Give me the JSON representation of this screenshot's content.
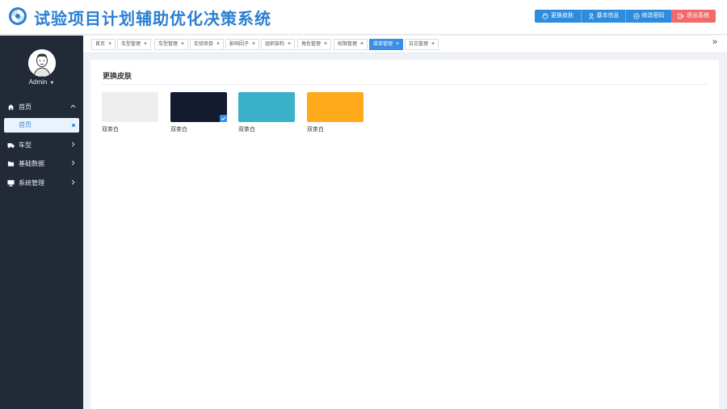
{
  "app": {
    "title": "试验项目计划辅助优化决策系统"
  },
  "header_buttons": {
    "change_skin": "更换皮肤",
    "basic_info": "基本信息",
    "change_password": "修改密码",
    "logout": "退出系统"
  },
  "user": {
    "name": "Admin"
  },
  "sidebar": {
    "items": [
      {
        "label": "首页",
        "icon": "home-icon",
        "expanded": true
      },
      {
        "label": "车型",
        "icon": "truck-icon",
        "expanded": false
      },
      {
        "label": "基础数据",
        "icon": "database-icon",
        "expanded": false
      },
      {
        "label": "系统管理",
        "icon": "monitor-icon",
        "expanded": false
      }
    ],
    "sub_item": {
      "label": "首页"
    }
  },
  "tabs": [
    {
      "label": "首页",
      "active": false
    },
    {
      "label": "车型管理",
      "active": false
    },
    {
      "label": "车型管理",
      "active": false
    },
    {
      "label": "实验项目",
      "active": false
    },
    {
      "label": "影响因子",
      "active": false
    },
    {
      "label": "组织架构",
      "active": false
    },
    {
      "label": "角色管理",
      "active": false
    },
    {
      "label": "权限管理",
      "active": false
    },
    {
      "label": "菜单管理",
      "active": true
    },
    {
      "label": "日志管理",
      "active": false
    }
  ],
  "tab_more_icon": "»",
  "content": {
    "title": "更换皮肤",
    "skins": [
      {
        "label": "双茶白",
        "color": "#eeeeee",
        "selected": false
      },
      {
        "label": "双茶白",
        "color": "#141a30",
        "selected": true
      },
      {
        "label": "双茶白",
        "color": "#3bb0c9",
        "selected": false
      },
      {
        "label": "双茶白",
        "color": "#ffaa1a",
        "selected": false
      }
    ]
  },
  "colors": {
    "primary": "#3a8ee6",
    "sidebar_bg": "#222a38",
    "danger": "#f06a6a",
    "title": "#2a7fd0"
  }
}
